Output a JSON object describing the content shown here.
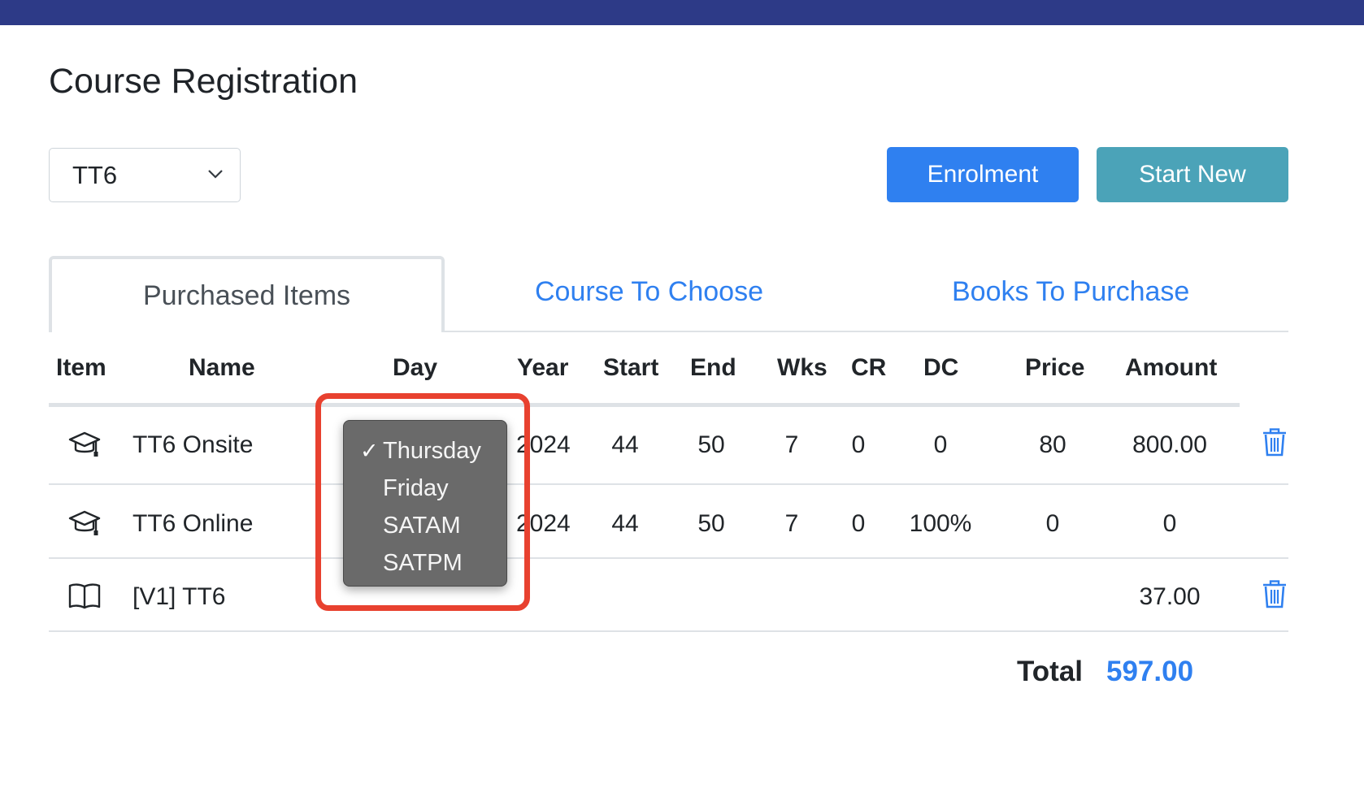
{
  "header": {
    "title": "Course Registration"
  },
  "controls": {
    "course_select_value": "TT6",
    "enrolment_label": "Enrolment",
    "start_new_label": "Start New"
  },
  "tabs": [
    {
      "label": "Purchased Items",
      "active": true
    },
    {
      "label": "Course To Choose",
      "active": false
    },
    {
      "label": "Books To Purchase",
      "active": false
    }
  ],
  "table": {
    "columns": [
      "Item",
      "Name",
      "Day",
      "Year",
      "Start",
      "End",
      "Wks",
      "CR",
      "DC",
      "Price",
      "Amount"
    ],
    "rows": [
      {
        "icon": "graduation-cap-icon",
        "name": "TT6 Onsite",
        "year": "2024",
        "start": "44",
        "end": "50",
        "wks": "7",
        "cr": "0",
        "dc": "0",
        "price": "80",
        "amount": "800.00",
        "deletable": true
      },
      {
        "icon": "graduation-cap-icon",
        "name": "TT6 Online",
        "year": "2024",
        "start": "44",
        "end": "50",
        "wks": "7",
        "cr": "0",
        "dc": "100%",
        "price": "0",
        "amount": "0",
        "deletable": false
      },
      {
        "icon": "book-icon",
        "name": "[V1] TT6",
        "amount": "37.00",
        "deletable": true
      }
    ]
  },
  "day_dropdown": {
    "options": [
      "Thursday",
      "Friday",
      "SATAM",
      "SATPM"
    ],
    "selected": "Thursday",
    "check_glyph": "✓"
  },
  "total": {
    "label": "Total",
    "value": "597.00"
  },
  "colors": {
    "accent": "#2f80f0",
    "teal": "#4ba3b8",
    "top_bar": "#2d3a87",
    "highlight": "#e8412f"
  }
}
